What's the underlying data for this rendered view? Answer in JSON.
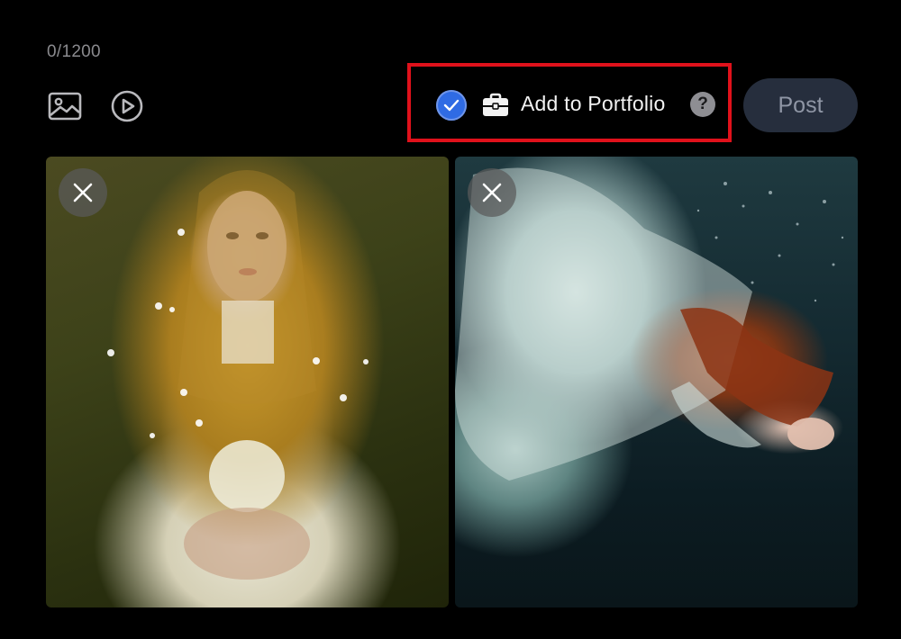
{
  "composer": {
    "char_count": "0/1200"
  },
  "toolbar": {
    "add_image": {
      "icon": "image-icon"
    },
    "add_video": {
      "icon": "play-circle-icon"
    },
    "portfolio": {
      "checked": true,
      "check_icon": "checkmark-icon",
      "briefcase_icon": "briefcase-icon",
      "label": "Add to Portfolio",
      "help_label": "?",
      "highlight_color": "#e0111b",
      "check_color": "#2f6be4"
    },
    "post_label": "Post"
  },
  "attachments": [
    {
      "type": "photo",
      "remove_icon": "close-icon"
    },
    {
      "type": "photo",
      "remove_icon": "close-icon"
    }
  ],
  "colors": {
    "background": "#000000",
    "post_button_bg": "#262e3d",
    "post_button_text": "#8f96a5",
    "muted_text": "#8a8a8e"
  }
}
